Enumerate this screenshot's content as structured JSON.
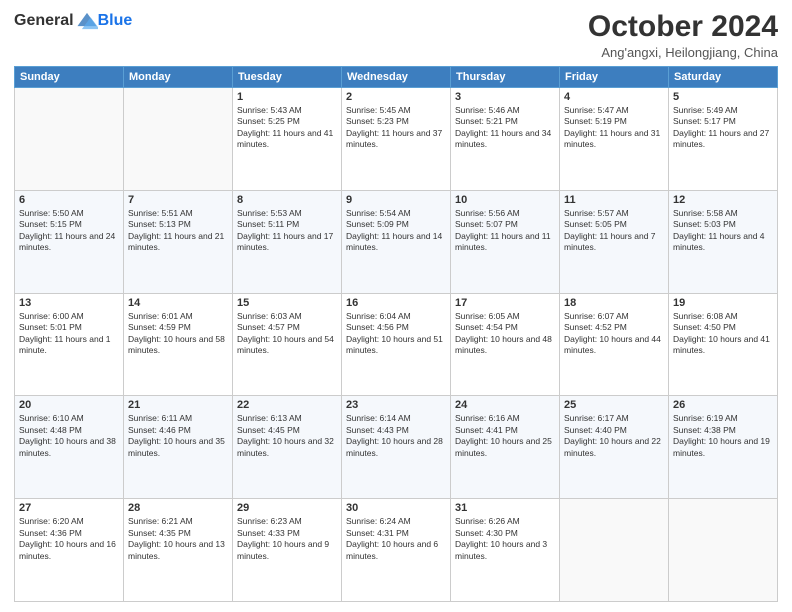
{
  "header": {
    "logo_general": "General",
    "logo_blue": "Blue",
    "month": "October 2024",
    "location": "Ang'angxi, Heilongjiang, China"
  },
  "days_of_week": [
    "Sunday",
    "Monday",
    "Tuesday",
    "Wednesday",
    "Thursday",
    "Friday",
    "Saturday"
  ],
  "weeks": [
    [
      {
        "day": "",
        "sunrise": "",
        "sunset": "",
        "daylight": ""
      },
      {
        "day": "",
        "sunrise": "",
        "sunset": "",
        "daylight": ""
      },
      {
        "day": "1",
        "sunrise": "Sunrise: 5:43 AM",
        "sunset": "Sunset: 5:25 PM",
        "daylight": "Daylight: 11 hours and 41 minutes."
      },
      {
        "day": "2",
        "sunrise": "Sunrise: 5:45 AM",
        "sunset": "Sunset: 5:23 PM",
        "daylight": "Daylight: 11 hours and 37 minutes."
      },
      {
        "day": "3",
        "sunrise": "Sunrise: 5:46 AM",
        "sunset": "Sunset: 5:21 PM",
        "daylight": "Daylight: 11 hours and 34 minutes."
      },
      {
        "day": "4",
        "sunrise": "Sunrise: 5:47 AM",
        "sunset": "Sunset: 5:19 PM",
        "daylight": "Daylight: 11 hours and 31 minutes."
      },
      {
        "day": "5",
        "sunrise": "Sunrise: 5:49 AM",
        "sunset": "Sunset: 5:17 PM",
        "daylight": "Daylight: 11 hours and 27 minutes."
      }
    ],
    [
      {
        "day": "6",
        "sunrise": "Sunrise: 5:50 AM",
        "sunset": "Sunset: 5:15 PM",
        "daylight": "Daylight: 11 hours and 24 minutes."
      },
      {
        "day": "7",
        "sunrise": "Sunrise: 5:51 AM",
        "sunset": "Sunset: 5:13 PM",
        "daylight": "Daylight: 11 hours and 21 minutes."
      },
      {
        "day": "8",
        "sunrise": "Sunrise: 5:53 AM",
        "sunset": "Sunset: 5:11 PM",
        "daylight": "Daylight: 11 hours and 17 minutes."
      },
      {
        "day": "9",
        "sunrise": "Sunrise: 5:54 AM",
        "sunset": "Sunset: 5:09 PM",
        "daylight": "Daylight: 11 hours and 14 minutes."
      },
      {
        "day": "10",
        "sunrise": "Sunrise: 5:56 AM",
        "sunset": "Sunset: 5:07 PM",
        "daylight": "Daylight: 11 hours and 11 minutes."
      },
      {
        "day": "11",
        "sunrise": "Sunrise: 5:57 AM",
        "sunset": "Sunset: 5:05 PM",
        "daylight": "Daylight: 11 hours and 7 minutes."
      },
      {
        "day": "12",
        "sunrise": "Sunrise: 5:58 AM",
        "sunset": "Sunset: 5:03 PM",
        "daylight": "Daylight: 11 hours and 4 minutes."
      }
    ],
    [
      {
        "day": "13",
        "sunrise": "Sunrise: 6:00 AM",
        "sunset": "Sunset: 5:01 PM",
        "daylight": "Daylight: 11 hours and 1 minute."
      },
      {
        "day": "14",
        "sunrise": "Sunrise: 6:01 AM",
        "sunset": "Sunset: 4:59 PM",
        "daylight": "Daylight: 10 hours and 58 minutes."
      },
      {
        "day": "15",
        "sunrise": "Sunrise: 6:03 AM",
        "sunset": "Sunset: 4:57 PM",
        "daylight": "Daylight: 10 hours and 54 minutes."
      },
      {
        "day": "16",
        "sunrise": "Sunrise: 6:04 AM",
        "sunset": "Sunset: 4:56 PM",
        "daylight": "Daylight: 10 hours and 51 minutes."
      },
      {
        "day": "17",
        "sunrise": "Sunrise: 6:05 AM",
        "sunset": "Sunset: 4:54 PM",
        "daylight": "Daylight: 10 hours and 48 minutes."
      },
      {
        "day": "18",
        "sunrise": "Sunrise: 6:07 AM",
        "sunset": "Sunset: 4:52 PM",
        "daylight": "Daylight: 10 hours and 44 minutes."
      },
      {
        "day": "19",
        "sunrise": "Sunrise: 6:08 AM",
        "sunset": "Sunset: 4:50 PM",
        "daylight": "Daylight: 10 hours and 41 minutes."
      }
    ],
    [
      {
        "day": "20",
        "sunrise": "Sunrise: 6:10 AM",
        "sunset": "Sunset: 4:48 PM",
        "daylight": "Daylight: 10 hours and 38 minutes."
      },
      {
        "day": "21",
        "sunrise": "Sunrise: 6:11 AM",
        "sunset": "Sunset: 4:46 PM",
        "daylight": "Daylight: 10 hours and 35 minutes."
      },
      {
        "day": "22",
        "sunrise": "Sunrise: 6:13 AM",
        "sunset": "Sunset: 4:45 PM",
        "daylight": "Daylight: 10 hours and 32 minutes."
      },
      {
        "day": "23",
        "sunrise": "Sunrise: 6:14 AM",
        "sunset": "Sunset: 4:43 PM",
        "daylight": "Daylight: 10 hours and 28 minutes."
      },
      {
        "day": "24",
        "sunrise": "Sunrise: 6:16 AM",
        "sunset": "Sunset: 4:41 PM",
        "daylight": "Daylight: 10 hours and 25 minutes."
      },
      {
        "day": "25",
        "sunrise": "Sunrise: 6:17 AM",
        "sunset": "Sunset: 4:40 PM",
        "daylight": "Daylight: 10 hours and 22 minutes."
      },
      {
        "day": "26",
        "sunrise": "Sunrise: 6:19 AM",
        "sunset": "Sunset: 4:38 PM",
        "daylight": "Daylight: 10 hours and 19 minutes."
      }
    ],
    [
      {
        "day": "27",
        "sunrise": "Sunrise: 6:20 AM",
        "sunset": "Sunset: 4:36 PM",
        "daylight": "Daylight: 10 hours and 16 minutes."
      },
      {
        "day": "28",
        "sunrise": "Sunrise: 6:21 AM",
        "sunset": "Sunset: 4:35 PM",
        "daylight": "Daylight: 10 hours and 13 minutes."
      },
      {
        "day": "29",
        "sunrise": "Sunrise: 6:23 AM",
        "sunset": "Sunset: 4:33 PM",
        "daylight": "Daylight: 10 hours and 9 minutes."
      },
      {
        "day": "30",
        "sunrise": "Sunrise: 6:24 AM",
        "sunset": "Sunset: 4:31 PM",
        "daylight": "Daylight: 10 hours and 6 minutes."
      },
      {
        "day": "31",
        "sunrise": "Sunrise: 6:26 AM",
        "sunset": "Sunset: 4:30 PM",
        "daylight": "Daylight: 10 hours and 3 minutes."
      },
      {
        "day": "",
        "sunrise": "",
        "sunset": "",
        "daylight": ""
      },
      {
        "day": "",
        "sunrise": "",
        "sunset": "",
        "daylight": ""
      }
    ]
  ]
}
